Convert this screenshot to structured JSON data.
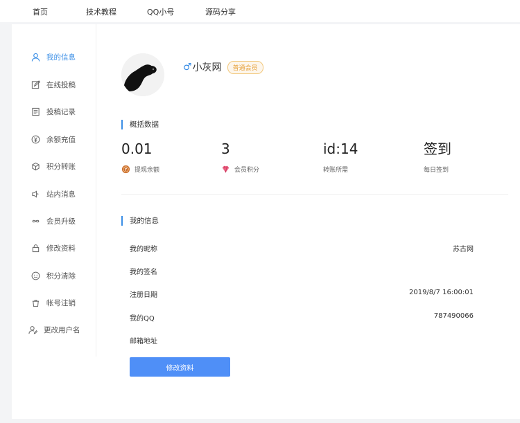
{
  "nav": {
    "items": [
      {
        "label": "首页"
      },
      {
        "label": "技术教程"
      },
      {
        "label": "QQ小号"
      },
      {
        "label": "源码分享"
      }
    ]
  },
  "sidebar": {
    "items": [
      {
        "label": "我的信息",
        "icon": "user-icon",
        "active": true
      },
      {
        "label": "在线投稿",
        "icon": "edit-icon"
      },
      {
        "label": "投稿记录",
        "icon": "record-icon"
      },
      {
        "label": "余额充值",
        "icon": "yen-icon"
      },
      {
        "label": "积分转账",
        "icon": "cube-icon"
      },
      {
        "label": "站内消息",
        "icon": "speaker-icon"
      },
      {
        "label": "会员升级",
        "icon": "infinity-icon"
      },
      {
        "label": "修改资料",
        "icon": "lock-icon"
      },
      {
        "label": "积分清除",
        "icon": "smile-icon"
      },
      {
        "label": "帐号注销",
        "icon": "trash-icon"
      },
      {
        "label": "更改用户名",
        "icon": "user-edit-icon"
      }
    ]
  },
  "profile": {
    "gender_symbol": "♂",
    "name": "小灰网",
    "badge": "普通会员"
  },
  "overview": {
    "title": "概括数据",
    "stats": [
      {
        "value": "0.01",
        "label": "提现余额",
        "icon": "coin-icon"
      },
      {
        "value": "3",
        "label": "会员积分",
        "icon": "diamond-icon"
      },
      {
        "value": "id:14",
        "label": "转账所需"
      },
      {
        "value": "签到",
        "label": "每日签到"
      }
    ]
  },
  "info": {
    "title": "我的信息",
    "rows": [
      {
        "key": "我的昵称",
        "value": "苏古网"
      },
      {
        "key": "我的签名",
        "value": ""
      },
      {
        "key": "注册日期",
        "value": "2019/8/7 16:00:01"
      },
      {
        "key": "我的QQ",
        "value": "787490066"
      },
      {
        "key": "邮箱地址",
        "value": ""
      }
    ],
    "edit_label": "修改资料"
  },
  "colors": {
    "accent": "#3a8ee6",
    "button": "#4f8ff7",
    "badge_text": "#e6a23c"
  }
}
